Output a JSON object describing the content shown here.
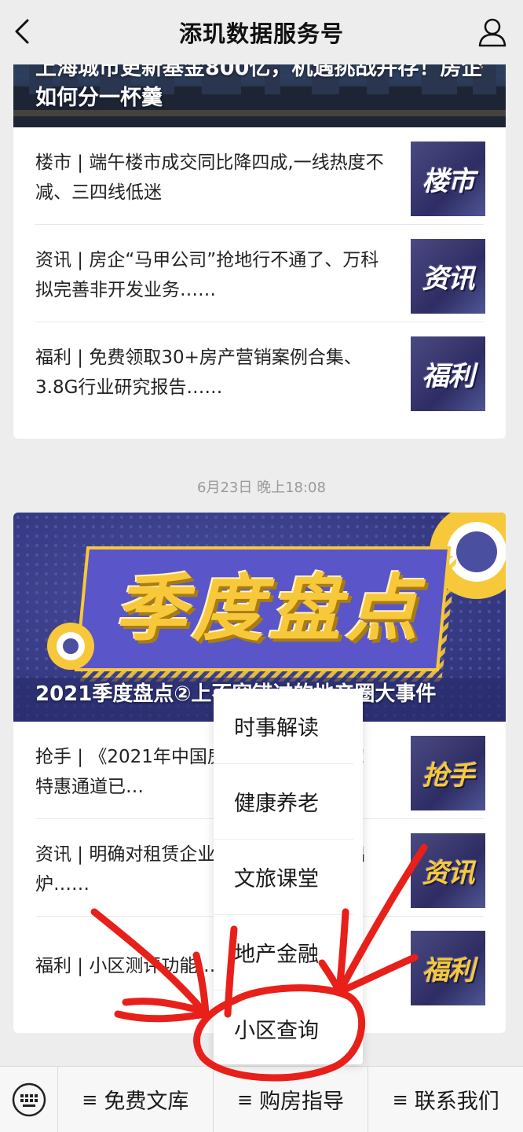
{
  "navbar": {
    "title": "添玑数据服务号",
    "back_icon": "chevron-left-icon",
    "user_icon": "user-icon"
  },
  "card1": {
    "cover_title": "上海城市更新基金800亿，机遇挑战并存！房企如何分一杯羹",
    "items": [
      {
        "text": "楼市 | 端午楼市成交同比降四成,一线热度不减、三四线低迷",
        "thumb": "楼市"
      },
      {
        "text": "资讯 | 房企“马甲公司”抢地行不通了、万科拟完善非开发业务……",
        "thumb": "资讯"
      },
      {
        "text": "福利 | 免费领取30+房产营销案例合集、3.8G行业研究报告……",
        "thumb": "福利"
      }
    ]
  },
  "timestamp": "6月23日 晚上18:08",
  "card2": {
    "banner_text": "季度盘点",
    "cover_title": "2021季度盘点②上不容错过的地产圈大事件",
    "items": [
      {
        "text": "抢手 | 《2021年中国房地产… 重磅发布！特惠通道已…",
        "thumb": "抢手"
      },
      {
        "text": "资讯 | 明确对租赁企业… 供地结果部分出炉……",
        "thumb": "资讯"
      },
      {
        "text": "福利 | 小区测评功能… …",
        "thumb": "福利"
      }
    ]
  },
  "popup_menu": {
    "items": [
      "时事解读",
      "健康养老",
      "文旅课堂",
      "地产金融",
      "小区查询"
    ]
  },
  "menubar": {
    "keyboard_icon": "keyboard-icon",
    "buttons": [
      "免费文库",
      "购房指导",
      "联系我们"
    ],
    "prefix": "≡"
  },
  "colors": {
    "annotation": "#e8201a",
    "thumb_bg": "#3a3a72",
    "banner_bg": "#3b3f8a",
    "banner_yellow": "#f7c83a"
  }
}
